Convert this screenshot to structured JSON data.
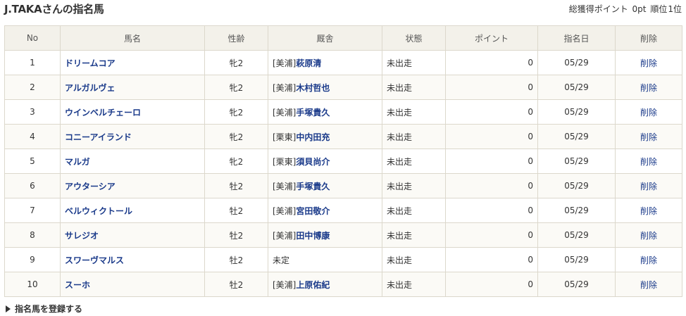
{
  "header": {
    "title": "J.TAKAさんの指名馬",
    "points_label": "総獲得ポイント",
    "points_value": "0pt",
    "rank_label": "順位",
    "rank_value": "1位"
  },
  "table": {
    "columns": [
      "No",
      "馬名",
      "性齢",
      "厩舎",
      "状態",
      "ポイント",
      "指名日",
      "削除"
    ],
    "rows": [
      {
        "no": "1",
        "name": "ドリームコア",
        "sex_age": "牝2",
        "stable_region": "[美浦]",
        "trainer": "萩原清",
        "status": "未出走",
        "points": "0",
        "date": "05/29",
        "delete": "削除"
      },
      {
        "no": "2",
        "name": "アルガルヴェ",
        "sex_age": "牝2",
        "stable_region": "[美浦]",
        "trainer": "木村哲也",
        "status": "未出走",
        "points": "0",
        "date": "05/29",
        "delete": "削除"
      },
      {
        "no": "3",
        "name": "ウインベルチェーロ",
        "sex_age": "牝2",
        "stable_region": "[美浦]",
        "trainer": "手塚貴久",
        "status": "未出走",
        "points": "0",
        "date": "05/29",
        "delete": "削除"
      },
      {
        "no": "4",
        "name": "コニーアイランド",
        "sex_age": "牝2",
        "stable_region": "[栗東]",
        "trainer": "中内田充",
        "status": "未出走",
        "points": "0",
        "date": "05/29",
        "delete": "削除"
      },
      {
        "no": "5",
        "name": "マルガ",
        "sex_age": "牝2",
        "stable_region": "[栗東]",
        "trainer": "須貝尚介",
        "status": "未出走",
        "points": "0",
        "date": "05/29",
        "delete": "削除"
      },
      {
        "no": "6",
        "name": "アウターシア",
        "sex_age": "牡2",
        "stable_region": "[美浦]",
        "trainer": "手塚貴久",
        "status": "未出走",
        "points": "0",
        "date": "05/29",
        "delete": "削除"
      },
      {
        "no": "7",
        "name": "ベルウィクトール",
        "sex_age": "牡2",
        "stable_region": "[美浦]",
        "trainer": "宮田敬介",
        "status": "未出走",
        "points": "0",
        "date": "05/29",
        "delete": "削除"
      },
      {
        "no": "8",
        "name": "サレジオ",
        "sex_age": "牡2",
        "stable_region": "[美浦]",
        "trainer": "田中博康",
        "status": "未出走",
        "points": "0",
        "date": "05/29",
        "delete": "削除"
      },
      {
        "no": "9",
        "name": "スワーヴマルス",
        "sex_age": "牡2",
        "stable_region": "未定",
        "trainer": "",
        "status": "未出走",
        "points": "0",
        "date": "05/29",
        "delete": "削除"
      },
      {
        "no": "10",
        "name": "スーホ",
        "sex_age": "牡2",
        "stable_region": "[美浦]",
        "trainer": "上原佑紀",
        "status": "未出走",
        "points": "0",
        "date": "05/29",
        "delete": "削除"
      }
    ]
  },
  "footer": {
    "register_link": "指名馬を登録する"
  }
}
